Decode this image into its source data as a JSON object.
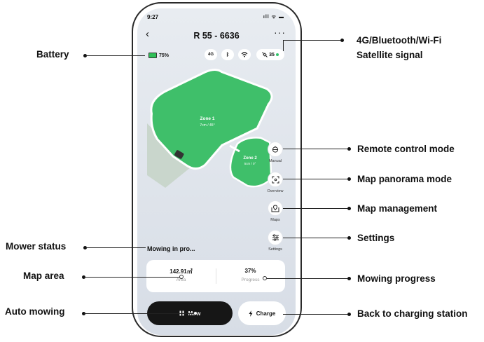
{
  "status_bar": {
    "time": "9:27",
    "icons": "ıll ᯤ ▬"
  },
  "header": {
    "back_icon": "‹",
    "title": "R 55 - 6636",
    "more_icon": "···"
  },
  "battery": {
    "percent": "75%",
    "color": "#2fbf57"
  },
  "connectivity": {
    "cellular": "4G",
    "bluetooth": "ᛒ",
    "wifi": "wifi",
    "satellite_count": "35",
    "ok_color": "#33c46b"
  },
  "map": {
    "zone1": {
      "name": "Zone 1",
      "detail": "7cm / 45°"
    },
    "zone2": {
      "name": "Zone 2",
      "detail": "5cm / 0°"
    },
    "lawn_color": "#3fbf6a"
  },
  "side_buttons": {
    "manual": "Manual",
    "overview": "Overview",
    "maps": "Maps",
    "settings": "Settings"
  },
  "mower_status": "Mowing in pro...",
  "stats": {
    "area_value": "142.91㎡",
    "area_label": "Area",
    "progress_value": "37%",
    "progress_label": "Progress"
  },
  "actions": {
    "mow_label": "Mow",
    "charge_label": "Charge"
  },
  "callouts": {
    "battery": "Battery",
    "mower_status": "Mower status",
    "map_area": "Map area",
    "auto_mowing": "Auto mowing",
    "signal_line1": "4G/Bluetooth/Wi-Fi",
    "signal_line2": "Satellite signal",
    "remote": "Remote control mode",
    "panorama": "Map panorama mode",
    "map_mgmt": "Map management",
    "settings": "Settings",
    "progress": "Mowing progress",
    "back_charge": "Back to charging station"
  }
}
